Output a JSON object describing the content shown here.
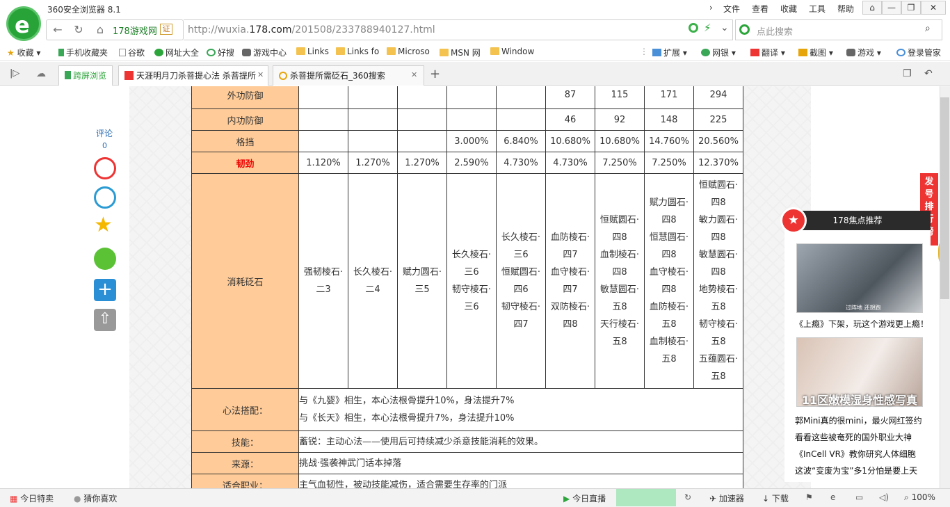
{
  "window": {
    "title": "360安全浏览器 8.1"
  },
  "menu": [
    "文件",
    "查看",
    "收藏",
    "工具",
    "帮助"
  ],
  "window_controls": {
    "home": "⌂",
    "minimize": "—",
    "maximize": "❐",
    "close": "✕"
  },
  "address": {
    "site_tag": "178游戏网",
    "cert_label": "证",
    "url_prefix": "http://wuxia.",
    "url_domain": "178.com",
    "url_path": "/201508/233788940127.html",
    "search_placeholder": "点此搜索"
  },
  "bookmarks": {
    "left": [
      "收藏",
      "手机收藏夹",
      "谷歌",
      "网址大全",
      "好搜",
      "游戏中心",
      "Links",
      "Links fo",
      "Microso",
      "MSN 网",
      "Window"
    ],
    "right": [
      "扩展",
      "网银",
      "翻译",
      "截图",
      "游戏",
      "登录管家"
    ]
  },
  "tabs": {
    "split_label": "跨屏浏览",
    "items": [
      {
        "label": "天涯明月刀杀菩提心法 杀菩提所"
      },
      {
        "label": "杀菩提所需砭石_360搜索"
      }
    ],
    "close_glyph": "✕",
    "new_tab": "+"
  },
  "table": {
    "rows": [
      {
        "header": "外功防御",
        "cells": [
          "",
          "",
          "",
          "",
          "",
          "87",
          "115",
          "171",
          "294"
        ]
      },
      {
        "header": "内功防御",
        "cells": [
          "",
          "",
          "",
          "",
          "",
          "46",
          "92",
          "148",
          "225"
        ]
      },
      {
        "header": "格挡",
        "cells": [
          "",
          "",
          "",
          "3.000%",
          "6.840%",
          "10.680%",
          "10.680%",
          "14.760%",
          "20.560%"
        ]
      },
      {
        "header": "韧劲",
        "cells": [
          "1.120%",
          "1.270%",
          "1.270%",
          "2.590%",
          "4.730%",
          "4.730%",
          "7.250%",
          "7.250%",
          "12.370%"
        ]
      }
    ],
    "stones": {
      "header": "消耗砭石",
      "cells": [
        [
          "强韧棱石·",
          "二3"
        ],
        [
          "长久棱石·",
          "二4"
        ],
        [
          "赋力圆石·",
          "三5"
        ],
        [
          "长久棱石·",
          "三6",
          "韧守棱石·",
          "三6"
        ],
        [
          "长久棱石·",
          "三6",
          "恒赋圆石·",
          "四6",
          "韧守棱石·",
          "四7"
        ],
        [
          "血防棱石·",
          "四7",
          "血守棱石·",
          "四7",
          "双防棱石·",
          "四8"
        ],
        [
          "恒赋圆石·",
          "四8",
          "血制棱石·",
          "四8",
          "敏慧圆石·",
          "五8",
          "天行棱石·",
          "五8"
        ],
        [
          "赋力圆石·",
          "四8",
          "恒慧圆石·",
          "四8",
          "血守棱石·",
          "四8",
          "血防棱石·",
          "五8",
          "血制棱石·",
          "五8"
        ],
        [
          "恒赋圆石·",
          "四8",
          "敏力圆石·",
          "四8",
          "敏慧圆石·",
          "四8",
          "地势棱石·",
          "五8",
          "韧守棱石·",
          "五8",
          "五蕴圆石·",
          "五8"
        ]
      ]
    },
    "info": [
      {
        "header": "心法搭配：",
        "lines": [
          "与《九婴》相生，本心法根骨提升10%，身法提升7%",
          "与《长天》相生，本心法根骨提升7%，身法提升10%"
        ]
      },
      {
        "header": "技能：",
        "lines": [
          "蓄锐：主动心法——使用后可持续减少杀意技能消耗的效果。"
        ]
      },
      {
        "header": "来源：",
        "lines": [
          "挑战·强袭神武门话本掉落"
        ]
      },
      {
        "header": "适合职业：",
        "lines": [
          "主气血韧性，被动技能减伤，适合需要生存率的门派"
        ]
      }
    ]
  },
  "share": {
    "comment_label": "评论",
    "comment_count": "0"
  },
  "right_panel": {
    "rank_label": "发号排行榜",
    "title": "178焦点推荐",
    "captions": [
      "《上瘾》下架，玩这个游戏更上瘾！",
      "11区嫩模湿身性感写真"
    ],
    "links": [
      "郭Mini真的很mini，最火网红签约",
      "看看这些被奄死的国外职业大神",
      "《InCell VR》教你研究人体细胞",
      "这波“变废为宝”多1分怕是要上天"
    ],
    "thumb_text": "过阵地 还想跑"
  },
  "status": {
    "left": [
      "今日特卖",
      "猜你喜欢"
    ],
    "right": [
      "今日直播",
      "加速器",
      "下载"
    ],
    "zoom": "100%"
  },
  "colors": {
    "brand_green": "#27a338",
    "header_cell": "#ffcc99",
    "accent_red": "#e33"
  }
}
